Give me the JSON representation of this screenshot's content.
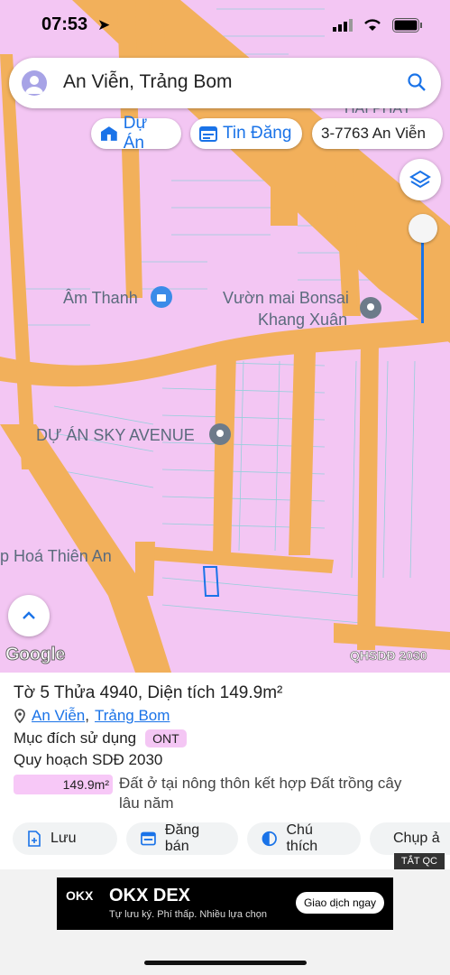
{
  "status_bar": {
    "time": "07:53"
  },
  "search": {
    "query": "An Viễn, Trảng Bom"
  },
  "chips": [
    {
      "label": "Dự Án"
    },
    {
      "label": "Tin Đăng"
    },
    {
      "label": "3-7763 An Viễn"
    }
  ],
  "map": {
    "labels": {
      "am_thanh": "Âm Thanh",
      "vuon_mai": "Vườn mai Bonsai",
      "khang_xuan": "Khang Xuân",
      "sky_avenue": "DỰ ÁN SKY AVENUE",
      "thien_an": "p Hoá Thiên An",
      "hai_phat": "HẢI PHÁT"
    },
    "attribution": "Google",
    "layer_code": "QHSDĐ 2030",
    "colors": {
      "land": "#f3c6f3",
      "road": "#f2b05b",
      "accent": "#1a73e8"
    }
  },
  "parcel": {
    "title": "Tờ 5 Thửa 4940, Diện tích 149.9m²",
    "location_ward": "An Viễn",
    "location_sep": ",",
    "location_district": "Trảng Bom",
    "purpose_label": "Mục đích sử dụng",
    "purpose_code": "ONT",
    "plan_label": "Quy hoạch SDĐ 2030",
    "plan_area": "149.9m²",
    "plan_desc": "Đất ở tại nông thôn kết hợp Đất trồng cây lâu năm"
  },
  "actions": [
    {
      "label": "Lưu"
    },
    {
      "label": "Đăng bán"
    },
    {
      "label": "Chú thích"
    },
    {
      "label": "Chụp ả"
    }
  ],
  "ad": {
    "close_label": "TẮT QC",
    "brand": "OKX",
    "title": "OKX DEX",
    "subtitle": "Tự lưu ký. Phí thấp. Nhiều lựa chọn",
    "cta": "Giao dịch ngay"
  }
}
